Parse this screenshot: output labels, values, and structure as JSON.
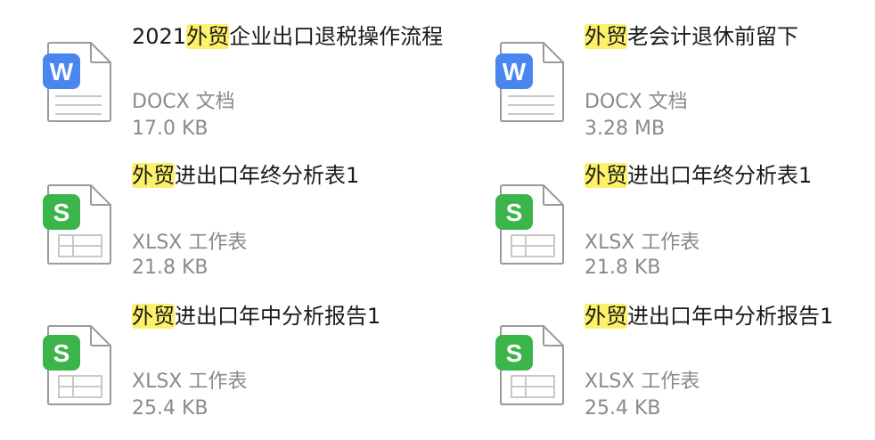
{
  "files": [
    {
      "prefix": "2021",
      "highlight": "外贸",
      "suffix": "企业出口退税操作流程",
      "type": "DOCX 文档",
      "size": "17.0 KB",
      "icon": "word-doc-icon",
      "badge_letter": "W",
      "badge_color": "#4a86f0"
    },
    {
      "prefix": "",
      "highlight": "外贸",
      "suffix": "老会计退休前留下",
      "type": "DOCX 文档",
      "size": "3.28 MB",
      "icon": "word-doc-icon",
      "badge_letter": "W",
      "badge_color": "#4a86f0"
    },
    {
      "prefix": "",
      "highlight": "外贸",
      "suffix": "进出口年终分析表1",
      "type": "XLSX 工作表",
      "size": "21.8 KB",
      "icon": "spreadsheet-icon",
      "badge_letter": "S",
      "badge_color": "#3bb54a"
    },
    {
      "prefix": "",
      "highlight": "外贸",
      "suffix": "进出口年终分析表1",
      "type": "XLSX 工作表",
      "size": "21.8 KB",
      "icon": "spreadsheet-icon",
      "badge_letter": "S",
      "badge_color": "#3bb54a"
    },
    {
      "prefix": "",
      "highlight": "外贸",
      "suffix": "进出口年中分析报告1",
      "type": "XLSX 工作表",
      "size": "25.4 KB",
      "icon": "spreadsheet-icon",
      "badge_letter": "S",
      "badge_color": "#3bb54a"
    },
    {
      "prefix": "",
      "highlight": "外贸",
      "suffix": "进出口年中分析报告1",
      "type": "XLSX 工作表",
      "size": "25.4 KB",
      "icon": "spreadsheet-icon",
      "badge_letter": "S",
      "badge_color": "#3bb54a"
    }
  ],
  "colors": {
    "highlight": "#fdf06a",
    "meta_text": "#8a8a8a",
    "name_text": "#1a1a1a",
    "page_outline": "#9a9a9a"
  }
}
